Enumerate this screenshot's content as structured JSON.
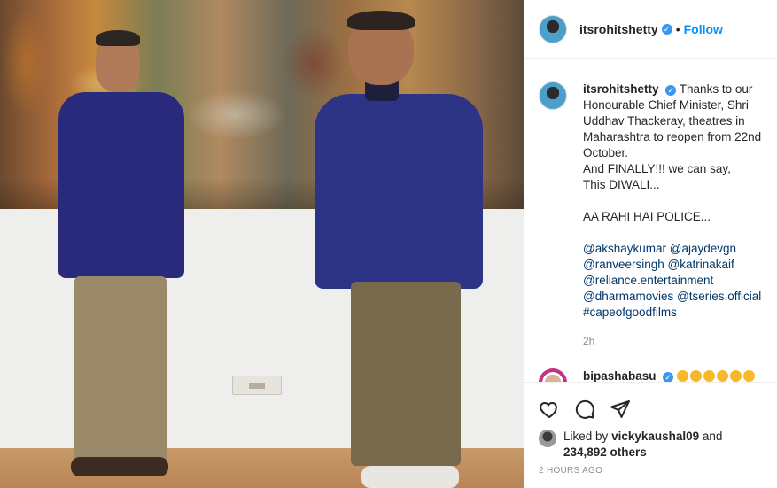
{
  "post": {
    "username": "itsrohitshetty",
    "follow_label": "Follow",
    "dot": "•",
    "verified_mark": "✓"
  },
  "caption": {
    "username": "itsrohitshetty",
    "lines": [
      "Thanks to our Honourable Chief Minister, Shri Uddhav Thackeray, theatres in Maharashtra to reopen from 22nd October.",
      "And FINALLY!!! we can say,",
      "This DIWALI...",
      "",
      "AA RAHI HAI POLICE..."
    ],
    "mentions": [
      [
        "@akshaykumar",
        "@ajaydevgn"
      ],
      [
        "@ranveersingh",
        "@katrinakaif"
      ],
      [
        "@reliance.entertainment"
      ],
      [
        "@dharmamovies",
        "@tseries.official"
      ]
    ],
    "hashtag": "#capeofgoodfilms",
    "time_ago": "2h"
  },
  "comment": {
    "username": "bipashabasu",
    "emoji_count": 6
  },
  "icons": [
    "heart-icon",
    "comment-icon",
    "share-icon"
  ],
  "likes": {
    "prefix": "Liked by",
    "user": "vickykaushal09",
    "and": "and",
    "count": "234,892 others"
  },
  "posted_label": "2 HOURS AGO",
  "colors": {
    "link": "#00376b",
    "follow": "#0095f6",
    "verified": "#3897f0",
    "muted": "#8e8e8e"
  }
}
